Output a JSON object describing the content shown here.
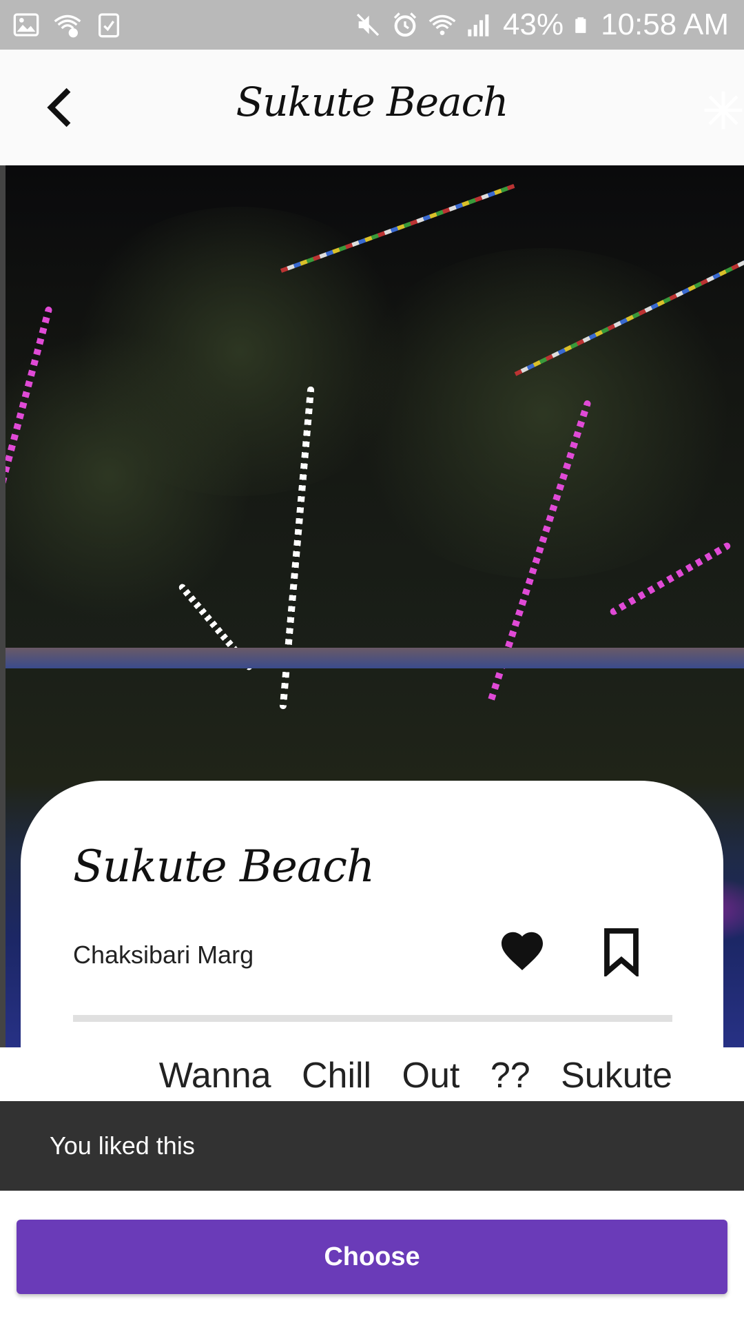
{
  "status_bar": {
    "battery": "43%",
    "time": "10:58 AM",
    "left_icons": [
      "gallery-icon",
      "wifi-alert-icon",
      "clipboard-check-icon"
    ],
    "right_icons": [
      "mute-icon",
      "alarm-icon",
      "wifi-icon",
      "signal-icon",
      "battery-icon"
    ]
  },
  "app_bar": {
    "title": "Sukute Beach",
    "back_icon": "chevron-left-icon",
    "action_icon": "snowflake-icon"
  },
  "card": {
    "title": "Sukute Beach",
    "address": "Chaksibari Marg",
    "liked": true,
    "description": "Wanna Chill Out ?? Sukute"
  },
  "snackbar": {
    "message": "You liked this"
  },
  "bottom": {
    "choose_label": "Choose"
  },
  "colors": {
    "accent": "#6a3bb8",
    "snackbar": "#323232",
    "status_bar": "#b9b9b9"
  }
}
